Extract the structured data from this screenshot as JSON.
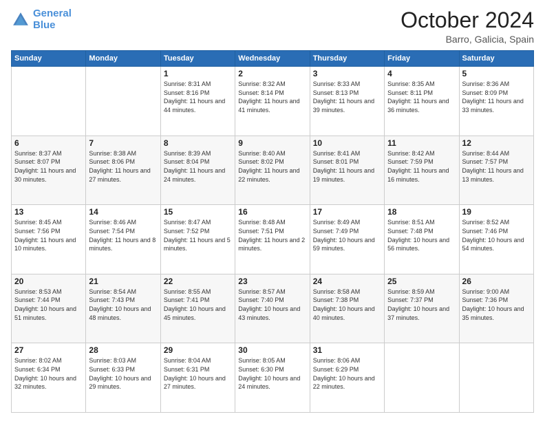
{
  "header": {
    "logo_line1": "General",
    "logo_line2": "Blue",
    "month": "October 2024",
    "location": "Barro, Galicia, Spain"
  },
  "weekdays": [
    "Sunday",
    "Monday",
    "Tuesday",
    "Wednesday",
    "Thursday",
    "Friday",
    "Saturday"
  ],
  "weeks": [
    [
      {
        "day": "",
        "sunrise": "",
        "sunset": "",
        "daylight": ""
      },
      {
        "day": "",
        "sunrise": "",
        "sunset": "",
        "daylight": ""
      },
      {
        "day": "1",
        "sunrise": "Sunrise: 8:31 AM",
        "sunset": "Sunset: 8:16 PM",
        "daylight": "Daylight: 11 hours and 44 minutes."
      },
      {
        "day": "2",
        "sunrise": "Sunrise: 8:32 AM",
        "sunset": "Sunset: 8:14 PM",
        "daylight": "Daylight: 11 hours and 41 minutes."
      },
      {
        "day": "3",
        "sunrise": "Sunrise: 8:33 AM",
        "sunset": "Sunset: 8:13 PM",
        "daylight": "Daylight: 11 hours and 39 minutes."
      },
      {
        "day": "4",
        "sunrise": "Sunrise: 8:35 AM",
        "sunset": "Sunset: 8:11 PM",
        "daylight": "Daylight: 11 hours and 36 minutes."
      },
      {
        "day": "5",
        "sunrise": "Sunrise: 8:36 AM",
        "sunset": "Sunset: 8:09 PM",
        "daylight": "Daylight: 11 hours and 33 minutes."
      }
    ],
    [
      {
        "day": "6",
        "sunrise": "Sunrise: 8:37 AM",
        "sunset": "Sunset: 8:07 PM",
        "daylight": "Daylight: 11 hours and 30 minutes."
      },
      {
        "day": "7",
        "sunrise": "Sunrise: 8:38 AM",
        "sunset": "Sunset: 8:06 PM",
        "daylight": "Daylight: 11 hours and 27 minutes."
      },
      {
        "day": "8",
        "sunrise": "Sunrise: 8:39 AM",
        "sunset": "Sunset: 8:04 PM",
        "daylight": "Daylight: 11 hours and 24 minutes."
      },
      {
        "day": "9",
        "sunrise": "Sunrise: 8:40 AM",
        "sunset": "Sunset: 8:02 PM",
        "daylight": "Daylight: 11 hours and 22 minutes."
      },
      {
        "day": "10",
        "sunrise": "Sunrise: 8:41 AM",
        "sunset": "Sunset: 8:01 PM",
        "daylight": "Daylight: 11 hours and 19 minutes."
      },
      {
        "day": "11",
        "sunrise": "Sunrise: 8:42 AM",
        "sunset": "Sunset: 7:59 PM",
        "daylight": "Daylight: 11 hours and 16 minutes."
      },
      {
        "day": "12",
        "sunrise": "Sunrise: 8:44 AM",
        "sunset": "Sunset: 7:57 PM",
        "daylight": "Daylight: 11 hours and 13 minutes."
      }
    ],
    [
      {
        "day": "13",
        "sunrise": "Sunrise: 8:45 AM",
        "sunset": "Sunset: 7:56 PM",
        "daylight": "Daylight: 11 hours and 10 minutes."
      },
      {
        "day": "14",
        "sunrise": "Sunrise: 8:46 AM",
        "sunset": "Sunset: 7:54 PM",
        "daylight": "Daylight: 11 hours and 8 minutes."
      },
      {
        "day": "15",
        "sunrise": "Sunrise: 8:47 AM",
        "sunset": "Sunset: 7:52 PM",
        "daylight": "Daylight: 11 hours and 5 minutes."
      },
      {
        "day": "16",
        "sunrise": "Sunrise: 8:48 AM",
        "sunset": "Sunset: 7:51 PM",
        "daylight": "Daylight: 11 hours and 2 minutes."
      },
      {
        "day": "17",
        "sunrise": "Sunrise: 8:49 AM",
        "sunset": "Sunset: 7:49 PM",
        "daylight": "Daylight: 10 hours and 59 minutes."
      },
      {
        "day": "18",
        "sunrise": "Sunrise: 8:51 AM",
        "sunset": "Sunset: 7:48 PM",
        "daylight": "Daylight: 10 hours and 56 minutes."
      },
      {
        "day": "19",
        "sunrise": "Sunrise: 8:52 AM",
        "sunset": "Sunset: 7:46 PM",
        "daylight": "Daylight: 10 hours and 54 minutes."
      }
    ],
    [
      {
        "day": "20",
        "sunrise": "Sunrise: 8:53 AM",
        "sunset": "Sunset: 7:44 PM",
        "daylight": "Daylight: 10 hours and 51 minutes."
      },
      {
        "day": "21",
        "sunrise": "Sunrise: 8:54 AM",
        "sunset": "Sunset: 7:43 PM",
        "daylight": "Daylight: 10 hours and 48 minutes."
      },
      {
        "day": "22",
        "sunrise": "Sunrise: 8:55 AM",
        "sunset": "Sunset: 7:41 PM",
        "daylight": "Daylight: 10 hours and 45 minutes."
      },
      {
        "day": "23",
        "sunrise": "Sunrise: 8:57 AM",
        "sunset": "Sunset: 7:40 PM",
        "daylight": "Daylight: 10 hours and 43 minutes."
      },
      {
        "day": "24",
        "sunrise": "Sunrise: 8:58 AM",
        "sunset": "Sunset: 7:38 PM",
        "daylight": "Daylight: 10 hours and 40 minutes."
      },
      {
        "day": "25",
        "sunrise": "Sunrise: 8:59 AM",
        "sunset": "Sunset: 7:37 PM",
        "daylight": "Daylight: 10 hours and 37 minutes."
      },
      {
        "day": "26",
        "sunrise": "Sunrise: 9:00 AM",
        "sunset": "Sunset: 7:36 PM",
        "daylight": "Daylight: 10 hours and 35 minutes."
      }
    ],
    [
      {
        "day": "27",
        "sunrise": "Sunrise: 8:02 AM",
        "sunset": "Sunset: 6:34 PM",
        "daylight": "Daylight: 10 hours and 32 minutes."
      },
      {
        "day": "28",
        "sunrise": "Sunrise: 8:03 AM",
        "sunset": "Sunset: 6:33 PM",
        "daylight": "Daylight: 10 hours and 29 minutes."
      },
      {
        "day": "29",
        "sunrise": "Sunrise: 8:04 AM",
        "sunset": "Sunset: 6:31 PM",
        "daylight": "Daylight: 10 hours and 27 minutes."
      },
      {
        "day": "30",
        "sunrise": "Sunrise: 8:05 AM",
        "sunset": "Sunset: 6:30 PM",
        "daylight": "Daylight: 10 hours and 24 minutes."
      },
      {
        "day": "31",
        "sunrise": "Sunrise: 8:06 AM",
        "sunset": "Sunset: 6:29 PM",
        "daylight": "Daylight: 10 hours and 22 minutes."
      },
      {
        "day": "",
        "sunrise": "",
        "sunset": "",
        "daylight": ""
      },
      {
        "day": "",
        "sunrise": "",
        "sunset": "",
        "daylight": ""
      }
    ]
  ]
}
